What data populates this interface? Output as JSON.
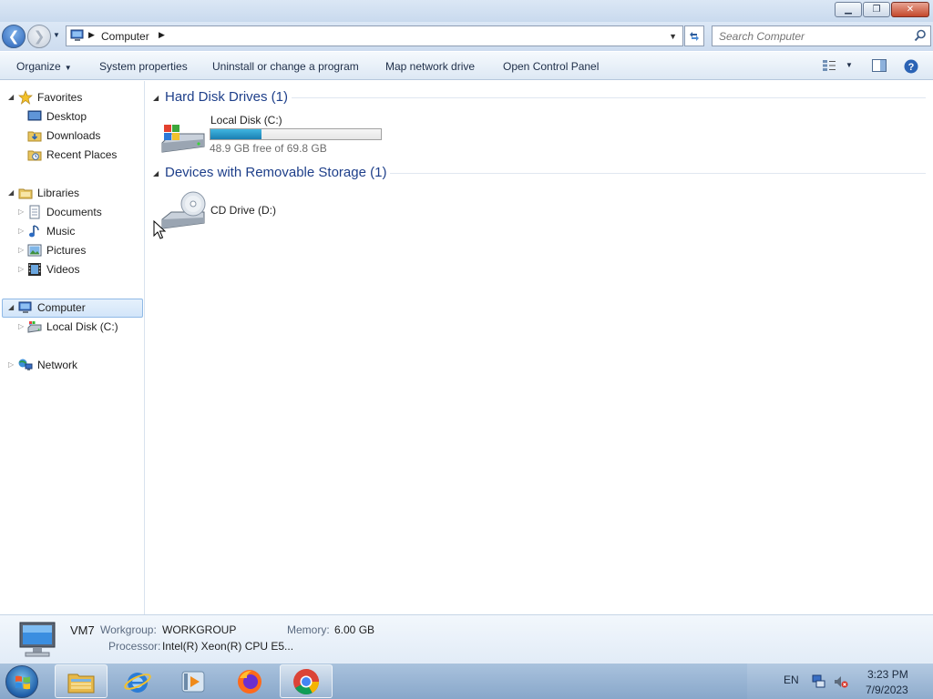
{
  "window": {
    "minimize_glyph": "▁",
    "maximize_glyph": "❐",
    "close_glyph": "✕"
  },
  "address": {
    "back_glyph": "❮",
    "forward_glyph": "❯",
    "path": "Computer",
    "search_placeholder": "Search Computer"
  },
  "commands": {
    "organize": "Organize",
    "system_properties": "System properties",
    "uninstall": "Uninstall or change a program",
    "map_network": "Map network drive",
    "control_panel": "Open Control Panel"
  },
  "nav": {
    "favorites": "Favorites",
    "desktop": "Desktop",
    "downloads": "Downloads",
    "recent": "Recent Places",
    "libraries": "Libraries",
    "documents": "Documents",
    "music": "Music",
    "pictures": "Pictures",
    "videos": "Videos",
    "computer": "Computer",
    "local_disk": "Local Disk (C:)",
    "network": "Network"
  },
  "content": {
    "hard_disk_group": "Hard Disk Drives (1)",
    "removable_group": "Devices with Removable Storage (1)",
    "drives": [
      {
        "name": "Local Disk (C:)",
        "free_text": "48.9 GB free of 69.8 GB",
        "used_fraction": 0.3
      }
    ],
    "removable": [
      {
        "name": "CD Drive (D:)"
      }
    ]
  },
  "details": {
    "computer_name": "VM7",
    "workgroup_label": "Workgroup:",
    "workgroup_value": "WORKGROUP",
    "memory_label": "Memory:",
    "memory_value": "6.00 GB",
    "processor_label": "Processor:",
    "processor_value": "Intel(R) Xeon(R) CPU E5..."
  },
  "taskbar": {
    "language": "EN",
    "time": "3:23 PM",
    "date": "7/9/2023"
  },
  "colors": {
    "accent": "#1e3f8a",
    "selection": "#d2e5f9",
    "capacity_fill": "#26a0d6"
  }
}
